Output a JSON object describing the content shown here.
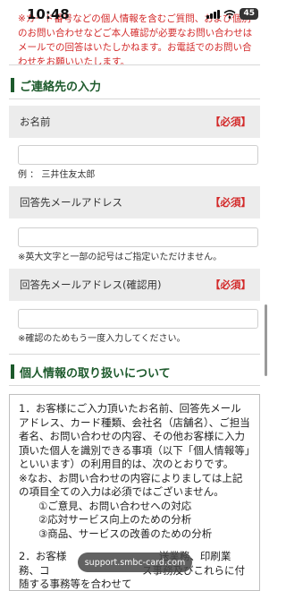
{
  "status": {
    "time": "10:48",
    "battery": "45"
  },
  "notice": "※カード番号などの個人情報を含むご質問、および個別のお問い合わせなどご本人確認が必要なお問い合わせはメールでの回答はいたしかねます。お電話でのお問い合わせをお願いいたします。",
  "contact": {
    "title": "ご連絡先の入力",
    "required_label": "【必須】",
    "name": {
      "label": "お名前",
      "hint": "例 ： 三井住友太郎"
    },
    "email": {
      "label": "回答先メールアドレス",
      "hint": "※英大文字と一部の記号はご指定いただけません。"
    },
    "email_confirm": {
      "label": "回答先メールアドレス(確認用)",
      "hint": "※確認のためもう一度入力してください。"
    }
  },
  "privacy": {
    "title": "個人情報の取り扱いについて",
    "p1": "1．お客様にご入力頂いたお名前、回答先メールアドレス、カード種類、会社名（店舗名）、ご担当者名、お問い合わせの内容、その他お客様に入力頂いた個人を識別できる事項（以下「個人情報等」といいます）の利用目的は、次のとおりです。",
    "p2": "※なお、お問い合わせの内容によりましては上記の項目全ての入力は必須ではございません。",
    "items": [
      "①ご意見、お問い合わせへの対応",
      "②応対サービス向上のための分析",
      "③商品、サービスの改善のための分析"
    ],
    "p3": "2．お客様　　　　　　　　　送業務、印刷業務、コ　　　　　　　　　ス事務及びこれらに付随する事務等を合わせて"
  },
  "browser": {
    "url": "support.smbc-card.com"
  }
}
